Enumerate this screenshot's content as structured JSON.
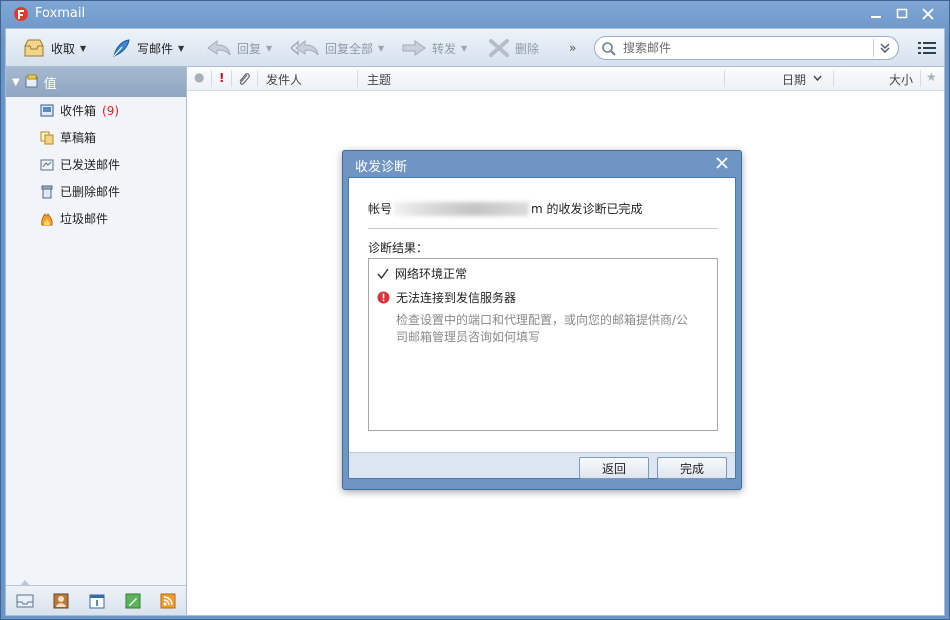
{
  "app": {
    "title": "Foxmail"
  },
  "toolbar": {
    "receive": "收取",
    "compose": "写邮件",
    "reply": "回复",
    "reply_all": "回复全部",
    "forward": "转发",
    "delete": "删除",
    "more": "»",
    "search_placeholder": "搜索邮件"
  },
  "sidebar": {
    "account": "值",
    "folders": [
      {
        "label": "收件箱",
        "count": "(9)",
        "icon": "inbox-icon"
      },
      {
        "label": "草稿箱",
        "icon": "drafts-icon"
      },
      {
        "label": "已发送邮件",
        "icon": "sent-icon"
      },
      {
        "label": "已删除邮件",
        "icon": "trash-icon"
      },
      {
        "label": "垃圾邮件",
        "icon": "junk-icon"
      }
    ],
    "bottom_icons": [
      "mail-icon",
      "contacts-icon",
      "calendar-icon",
      "notes-icon",
      "rss-icon"
    ]
  },
  "list": {
    "columns": {
      "flag": "!",
      "sender": "发件人",
      "subject": "主题",
      "date": "日期",
      "size": "大小"
    }
  },
  "dialog": {
    "title": "收发诊断",
    "status_prefix": "帐号",
    "status_suffix": "m 的收发诊断已完成",
    "result_label": "诊断结果：",
    "results": [
      {
        "text": "网络环境正常",
        "status": "ok"
      },
      {
        "text": "无法连接到发信服务器",
        "status": "error"
      }
    ],
    "hint": "检查设置中的端口和代理配置，或向您的邮箱提供商/公司邮箱管理员咨询如何填写",
    "back_button": "返回",
    "done_button": "完成"
  },
  "colors": {
    "accent": "#6a95c8",
    "error": "#d9343a",
    "count": "#dd2222"
  }
}
